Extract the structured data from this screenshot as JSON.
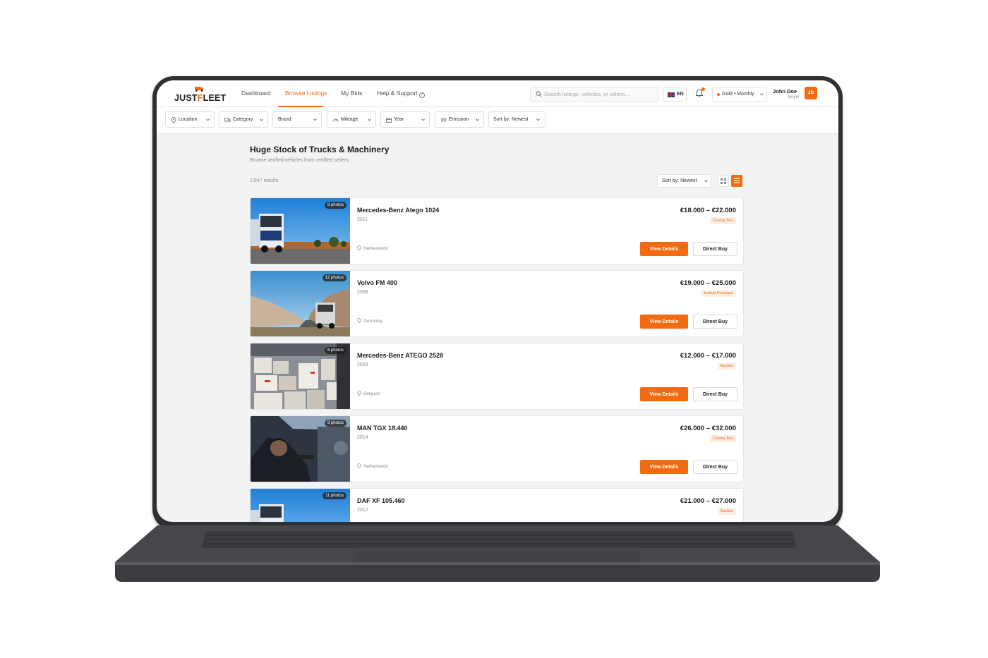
{
  "brand": {
    "logo_prefix": "JUST",
    "logo_accent": "F",
    "logo_suffix": "LEET",
    "accent_color": "#f26b12"
  },
  "nav": {
    "items": [
      {
        "label": "Dashboard",
        "active": false
      },
      {
        "label": "Browse Listings",
        "active": true
      },
      {
        "label": "My Bids",
        "active": false
      },
      {
        "label": "Help & Support",
        "active": false
      }
    ]
  },
  "search": {
    "placeholder": "Search listings, vehicles, or sellers..."
  },
  "language": {
    "code": "EN",
    "flag_icon": "uk-flag-icon"
  },
  "plan": {
    "label": "Gold • Monthly"
  },
  "user": {
    "name": "John Doe",
    "role": "Buyer",
    "initials": "JD"
  },
  "filters": [
    {
      "label": "Location",
      "icon": "location-pin-icon"
    },
    {
      "label": "Category",
      "icon": "truck-icon"
    },
    {
      "label": "Brand",
      "icon": ""
    },
    {
      "label": "Mileage",
      "icon": "gauge-icon"
    },
    {
      "label": "Year",
      "icon": "calendar-icon"
    },
    {
      "label": "Emission",
      "icon": "leaf-icon"
    },
    {
      "label": "Sort by: Newest",
      "icon": ""
    }
  ],
  "page": {
    "title": "Huge Stock of Trucks & Machinery",
    "subtitle": "Browse verified vehicles from certified sellers.",
    "results": "2,847 results",
    "sort_label": "Sort by: Newest"
  },
  "listings": [
    {
      "title": "Mercedes-Benz Atego 1024",
      "year": "2011",
      "location": "Netherlands",
      "price": "€18.000 – €22.000",
      "tag": "Closing Bos",
      "photos": "8 photos",
      "image": "truck-desert"
    },
    {
      "title": "Volvo FM 400",
      "year": "2008",
      "location": "Germany",
      "price": "€19.000 – €25.000",
      "tag": "Instant Purchase",
      "photos": "12 photos",
      "image": "truck-mountain"
    },
    {
      "title": "Mercedes-Benz ATEGO 2528",
      "year": "2003",
      "location": "Belgium",
      "price": "€12.000 – €17.000",
      "tag": "Auction",
      "photos": "6 photos",
      "image": "cargo-boxes"
    },
    {
      "title": "MAN TGX 18.440",
      "year": "2014",
      "location": "Netherlands",
      "price": "€26.000 – €32.000",
      "tag": "Closing Bos",
      "photos": "9 photos",
      "image": "mechanic"
    },
    {
      "title": "DAF XF 105.460",
      "year": "2012",
      "location": "",
      "price": "€21.000 – €27.000",
      "tag": "Auction",
      "photos": "11 photos",
      "image": "truck-desert"
    }
  ],
  "buttons": {
    "view": "View Details",
    "buy": "Direct Buy"
  }
}
